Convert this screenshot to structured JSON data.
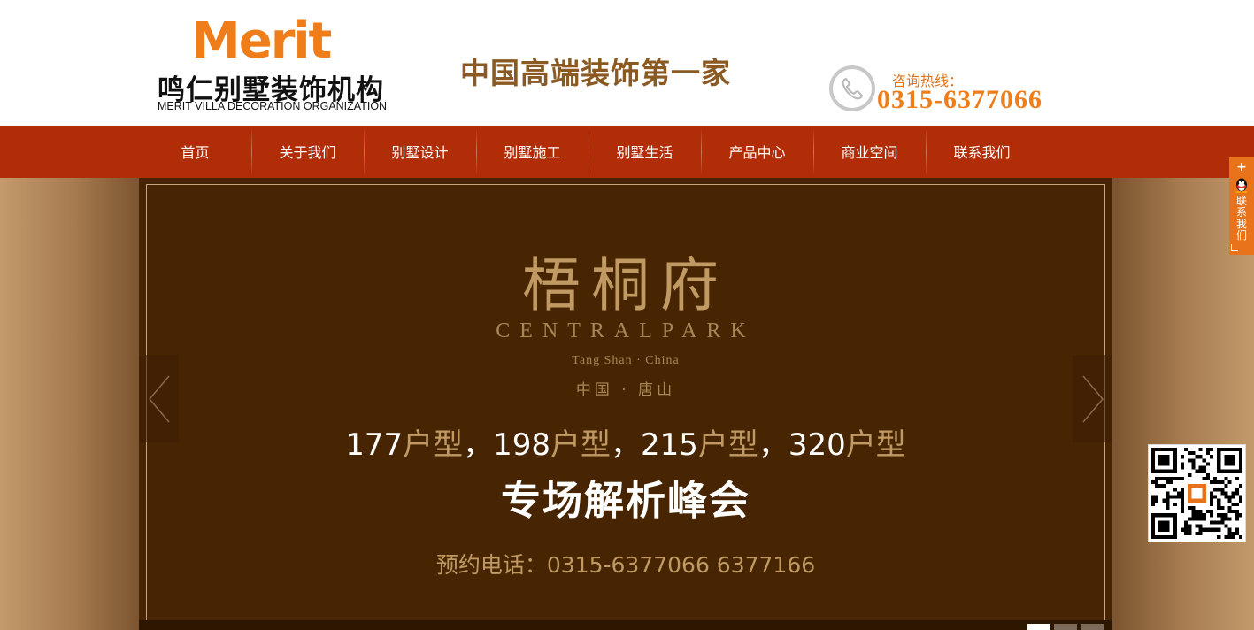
{
  "header": {
    "logo_brand": "Merit",
    "logo_cn": "鸣仁别墅装饰机构",
    "logo_en": "MERIT VILLA DECORATION ORGANIZATION",
    "slogan": "中国高端装饰第一家",
    "hotline_label": "咨询热线：",
    "hotline_number": "0315-6377066"
  },
  "nav": {
    "items": [
      {
        "label": "首页"
      },
      {
        "label": "关于我们"
      },
      {
        "label": "别墅设计"
      },
      {
        "label": "别墅施工"
      },
      {
        "label": "别墅生活"
      },
      {
        "label": "产品中心"
      },
      {
        "label": "商业空间"
      },
      {
        "label": "联系我们"
      }
    ]
  },
  "banner": {
    "title_cn": "梧桐府",
    "title_en": "CENTRALPARK",
    "sub_en": "Tang Shan · China",
    "sub_cn": "中国 · 唐山",
    "types": [
      {
        "num": "177",
        "unit": "户型"
      },
      {
        "num": "198",
        "unit": "户型"
      },
      {
        "num": "215",
        "unit": "户型"
      },
      {
        "num": "320",
        "unit": "户型"
      }
    ],
    "separator": "，",
    "event": "专场解析峰会",
    "contact": "预约电话：0315-6377066   6377166",
    "slide_count": 3,
    "active_slide": 1
  },
  "float_contact": {
    "label": "联系我们"
  },
  "colors": {
    "brand_orange": "#ef7d1a",
    "nav_red": "#b02d07",
    "slide_brown": "#472502",
    "gold": "#c09a62"
  },
  "icons": {
    "phone": "phone-icon",
    "arrow_left": "chevron-left-icon",
    "arrow_right": "chevron-right-icon",
    "qq": "qq-penguin-icon",
    "qr": "qr-code"
  }
}
